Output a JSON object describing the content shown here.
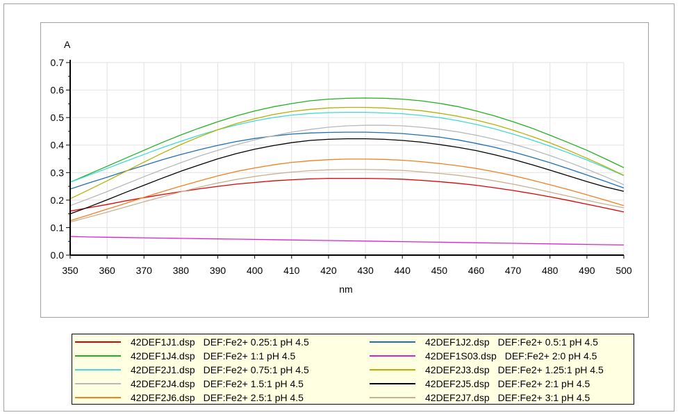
{
  "chart_data": {
    "type": "line",
    "title": "",
    "xlabel": "nm",
    "ylabel": "A",
    "xlim": [
      350,
      500
    ],
    "ylim": [
      0,
      0.7
    ],
    "x_ticks": [
      "350",
      "360",
      "370",
      "380",
      "390",
      "400",
      "410",
      "420",
      "430",
      "440",
      "450",
      "460",
      "470",
      "480",
      "490",
      "500"
    ],
    "y_ticks": [
      "0.0",
      "0.1",
      "0.2",
      "0.3",
      "0.4",
      "0.5",
      "0.6",
      "0.7"
    ],
    "grid": true,
    "legend_position": "bottom",
    "x": [
      350,
      355,
      360,
      365,
      370,
      375,
      380,
      385,
      390,
      395,
      400,
      405,
      410,
      415,
      420,
      425,
      430,
      435,
      440,
      445,
      450,
      455,
      460,
      465,
      470,
      475,
      480,
      485,
      490,
      495,
      500
    ],
    "series": [
      {
        "name": "42DEF1J1.dsp",
        "description": "DEF:Fe2+ 0.25:1 pH 4.5",
        "color": "#e00000",
        "values": [
          0.16,
          0.172,
          0.184,
          0.197,
          0.209,
          0.22,
          0.231,
          0.241,
          0.25,
          0.258,
          0.264,
          0.27,
          0.274,
          0.277,
          0.279,
          0.279,
          0.279,
          0.278,
          0.276,
          0.272,
          0.267,
          0.261,
          0.254,
          0.245,
          0.235,
          0.224,
          0.212,
          0.199,
          0.185,
          0.171,
          0.157
        ]
      },
      {
        "name": "42DEF1J2.dsp",
        "description": "DEF:Fe2+ 0.5:1 pH 4.5",
        "color": "#1f6fb4",
        "values": [
          0.24,
          0.262,
          0.283,
          0.305,
          0.326,
          0.347,
          0.366,
          0.383,
          0.399,
          0.413,
          0.424,
          0.433,
          0.44,
          0.444,
          0.446,
          0.447,
          0.447,
          0.445,
          0.442,
          0.436,
          0.429,
          0.419,
          0.406,
          0.392,
          0.375,
          0.356,
          0.336,
          0.314,
          0.291,
          0.268,
          0.244
        ]
      },
      {
        "name": "42DEF1J4.dsp",
        "description": "DEF:Fe2+ 1:1 pH 4.5",
        "color": "#22b022",
        "values": [
          0.265,
          0.294,
          0.323,
          0.352,
          0.381,
          0.41,
          0.437,
          0.462,
          0.485,
          0.506,
          0.524,
          0.539,
          0.551,
          0.561,
          0.567,
          0.57,
          0.571,
          0.57,
          0.567,
          0.561,
          0.552,
          0.54,
          0.524,
          0.506,
          0.485,
          0.462,
          0.436,
          0.409,
          0.381,
          0.35,
          0.318
        ]
      },
      {
        "name": "42DEF1S03.dsp",
        "description": "DEF:Fe2+ 2:0 pH 4.5",
        "color": "#e020d0",
        "values": [
          0.068,
          0.066,
          0.065,
          0.064,
          0.063,
          0.062,
          0.061,
          0.06,
          0.059,
          0.058,
          0.057,
          0.056,
          0.055,
          0.054,
          0.053,
          0.052,
          0.051,
          0.05,
          0.049,
          0.048,
          0.047,
          0.046,
          0.045,
          0.044,
          0.043,
          0.042,
          0.041,
          0.04,
          0.039,
          0.038,
          0.037
        ]
      },
      {
        "name": "42DEF2J1.dsp",
        "description": "DEF:Fe2+ 0.75:1 pH 4.5",
        "color": "#40d8d8",
        "values": [
          0.265,
          0.29,
          0.315,
          0.341,
          0.366,
          0.391,
          0.414,
          0.436,
          0.456,
          0.473,
          0.488,
          0.5,
          0.509,
          0.515,
          0.518,
          0.519,
          0.519,
          0.517,
          0.514,
          0.508,
          0.5,
          0.489,
          0.475,
          0.459,
          0.44,
          0.419,
          0.396,
          0.372,
          0.346,
          0.318,
          0.289
        ]
      },
      {
        "name": "42DEF2J3.dsp",
        "description": "DEF:Fe2+ 1.25:1 pH 4.5",
        "color": "#b8b000",
        "values": [
          0.205,
          0.237,
          0.27,
          0.304,
          0.338,
          0.371,
          0.402,
          0.43,
          0.456,
          0.478,
          0.496,
          0.511,
          0.522,
          0.53,
          0.535,
          0.537,
          0.537,
          0.535,
          0.531,
          0.525,
          0.516,
          0.505,
          0.491,
          0.474,
          0.454,
          0.432,
          0.408,
          0.381,
          0.352,
          0.322,
          0.29
        ]
      },
      {
        "name": "42DEF2J4.dsp",
        "description": "DEF:Fe2+ 1.5:1 pH 4.5",
        "color": "#b8b8b8",
        "values": [
          0.18,
          0.205,
          0.231,
          0.258,
          0.285,
          0.311,
          0.336,
          0.36,
          0.381,
          0.401,
          0.419,
          0.434,
          0.447,
          0.457,
          0.465,
          0.47,
          0.472,
          0.472,
          0.47,
          0.465,
          0.458,
          0.448,
          0.436,
          0.421,
          0.404,
          0.384,
          0.362,
          0.338,
          0.312,
          0.285,
          0.256
        ]
      },
      {
        "name": "42DEF2J5.dsp",
        "description": "DEF:Fe2+ 2:1 pH 4.5",
        "color": "#000000",
        "values": [
          0.15,
          0.175,
          0.201,
          0.228,
          0.254,
          0.28,
          0.305,
          0.328,
          0.35,
          0.369,
          0.385,
          0.398,
          0.409,
          0.417,
          0.421,
          0.423,
          0.423,
          0.421,
          0.417,
          0.411,
          0.402,
          0.392,
          0.38,
          0.365,
          0.348,
          0.329,
          0.309,
          0.288,
          0.267,
          0.248,
          0.232
        ]
      },
      {
        "name": "42DEF2J6.dsp",
        "description": "DEF:Fe2+ 2.5:1 pH 4.5",
        "color": "#f08020",
        "values": [
          0.125,
          0.146,
          0.167,
          0.188,
          0.21,
          0.231,
          0.251,
          0.27,
          0.288,
          0.304,
          0.317,
          0.328,
          0.337,
          0.343,
          0.347,
          0.349,
          0.349,
          0.348,
          0.345,
          0.34,
          0.333,
          0.325,
          0.315,
          0.303,
          0.289,
          0.273,
          0.256,
          0.238,
          0.219,
          0.2,
          0.18
        ]
      },
      {
        "name": "42DEF2J7.dsp",
        "description": "DEF:Fe2+ 3:1 pH 4.5",
        "color": "#c8b090",
        "values": [
          0.12,
          0.138,
          0.156,
          0.175,
          0.194,
          0.212,
          0.23,
          0.247,
          0.262,
          0.275,
          0.286,
          0.295,
          0.302,
          0.307,
          0.31,
          0.311,
          0.311,
          0.31,
          0.308,
          0.303,
          0.297,
          0.29,
          0.281,
          0.27,
          0.258,
          0.244,
          0.229,
          0.214,
          0.199,
          0.185,
          0.172
        ]
      }
    ],
    "legend_order": [
      0,
      1,
      2,
      3,
      4,
      5,
      6,
      7,
      8,
      9
    ]
  }
}
